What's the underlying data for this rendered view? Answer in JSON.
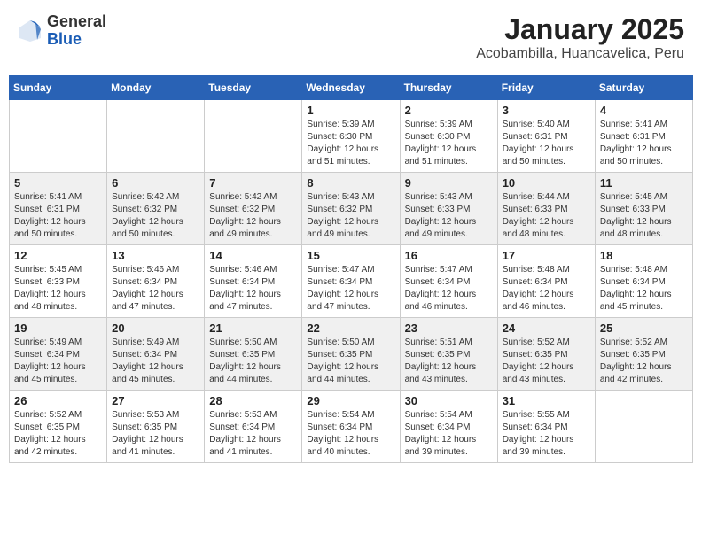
{
  "header": {
    "logo_general": "General",
    "logo_blue": "Blue",
    "month_title": "January 2025",
    "location": "Acobambilla, Huancavelica, Peru"
  },
  "weekdays": [
    "Sunday",
    "Monday",
    "Tuesday",
    "Wednesday",
    "Thursday",
    "Friday",
    "Saturday"
  ],
  "weeks": [
    [
      {
        "day": "",
        "info": ""
      },
      {
        "day": "",
        "info": ""
      },
      {
        "day": "",
        "info": ""
      },
      {
        "day": "1",
        "info": "Sunrise: 5:39 AM\nSunset: 6:30 PM\nDaylight: 12 hours\nand 51 minutes."
      },
      {
        "day": "2",
        "info": "Sunrise: 5:39 AM\nSunset: 6:30 PM\nDaylight: 12 hours\nand 51 minutes."
      },
      {
        "day": "3",
        "info": "Sunrise: 5:40 AM\nSunset: 6:31 PM\nDaylight: 12 hours\nand 50 minutes."
      },
      {
        "day": "4",
        "info": "Sunrise: 5:41 AM\nSunset: 6:31 PM\nDaylight: 12 hours\nand 50 minutes."
      }
    ],
    [
      {
        "day": "5",
        "info": "Sunrise: 5:41 AM\nSunset: 6:31 PM\nDaylight: 12 hours\nand 50 minutes."
      },
      {
        "day": "6",
        "info": "Sunrise: 5:42 AM\nSunset: 6:32 PM\nDaylight: 12 hours\nand 50 minutes."
      },
      {
        "day": "7",
        "info": "Sunrise: 5:42 AM\nSunset: 6:32 PM\nDaylight: 12 hours\nand 49 minutes."
      },
      {
        "day": "8",
        "info": "Sunrise: 5:43 AM\nSunset: 6:32 PM\nDaylight: 12 hours\nand 49 minutes."
      },
      {
        "day": "9",
        "info": "Sunrise: 5:43 AM\nSunset: 6:33 PM\nDaylight: 12 hours\nand 49 minutes."
      },
      {
        "day": "10",
        "info": "Sunrise: 5:44 AM\nSunset: 6:33 PM\nDaylight: 12 hours\nand 48 minutes."
      },
      {
        "day": "11",
        "info": "Sunrise: 5:45 AM\nSunset: 6:33 PM\nDaylight: 12 hours\nand 48 minutes."
      }
    ],
    [
      {
        "day": "12",
        "info": "Sunrise: 5:45 AM\nSunset: 6:33 PM\nDaylight: 12 hours\nand 48 minutes."
      },
      {
        "day": "13",
        "info": "Sunrise: 5:46 AM\nSunset: 6:34 PM\nDaylight: 12 hours\nand 47 minutes."
      },
      {
        "day": "14",
        "info": "Sunrise: 5:46 AM\nSunset: 6:34 PM\nDaylight: 12 hours\nand 47 minutes."
      },
      {
        "day": "15",
        "info": "Sunrise: 5:47 AM\nSunset: 6:34 PM\nDaylight: 12 hours\nand 47 minutes."
      },
      {
        "day": "16",
        "info": "Sunrise: 5:47 AM\nSunset: 6:34 PM\nDaylight: 12 hours\nand 46 minutes."
      },
      {
        "day": "17",
        "info": "Sunrise: 5:48 AM\nSunset: 6:34 PM\nDaylight: 12 hours\nand 46 minutes."
      },
      {
        "day": "18",
        "info": "Sunrise: 5:48 AM\nSunset: 6:34 PM\nDaylight: 12 hours\nand 45 minutes."
      }
    ],
    [
      {
        "day": "19",
        "info": "Sunrise: 5:49 AM\nSunset: 6:34 PM\nDaylight: 12 hours\nand 45 minutes."
      },
      {
        "day": "20",
        "info": "Sunrise: 5:49 AM\nSunset: 6:34 PM\nDaylight: 12 hours\nand 45 minutes."
      },
      {
        "day": "21",
        "info": "Sunrise: 5:50 AM\nSunset: 6:35 PM\nDaylight: 12 hours\nand 44 minutes."
      },
      {
        "day": "22",
        "info": "Sunrise: 5:50 AM\nSunset: 6:35 PM\nDaylight: 12 hours\nand 44 minutes."
      },
      {
        "day": "23",
        "info": "Sunrise: 5:51 AM\nSunset: 6:35 PM\nDaylight: 12 hours\nand 43 minutes."
      },
      {
        "day": "24",
        "info": "Sunrise: 5:52 AM\nSunset: 6:35 PM\nDaylight: 12 hours\nand 43 minutes."
      },
      {
        "day": "25",
        "info": "Sunrise: 5:52 AM\nSunset: 6:35 PM\nDaylight: 12 hours\nand 42 minutes."
      }
    ],
    [
      {
        "day": "26",
        "info": "Sunrise: 5:52 AM\nSunset: 6:35 PM\nDaylight: 12 hours\nand 42 minutes."
      },
      {
        "day": "27",
        "info": "Sunrise: 5:53 AM\nSunset: 6:35 PM\nDaylight: 12 hours\nand 41 minutes."
      },
      {
        "day": "28",
        "info": "Sunrise: 5:53 AM\nSunset: 6:34 PM\nDaylight: 12 hours\nand 41 minutes."
      },
      {
        "day": "29",
        "info": "Sunrise: 5:54 AM\nSunset: 6:34 PM\nDaylight: 12 hours\nand 40 minutes."
      },
      {
        "day": "30",
        "info": "Sunrise: 5:54 AM\nSunset: 6:34 PM\nDaylight: 12 hours\nand 39 minutes."
      },
      {
        "day": "31",
        "info": "Sunrise: 5:55 AM\nSunset: 6:34 PM\nDaylight: 12 hours\nand 39 minutes."
      },
      {
        "day": "",
        "info": ""
      }
    ]
  ]
}
